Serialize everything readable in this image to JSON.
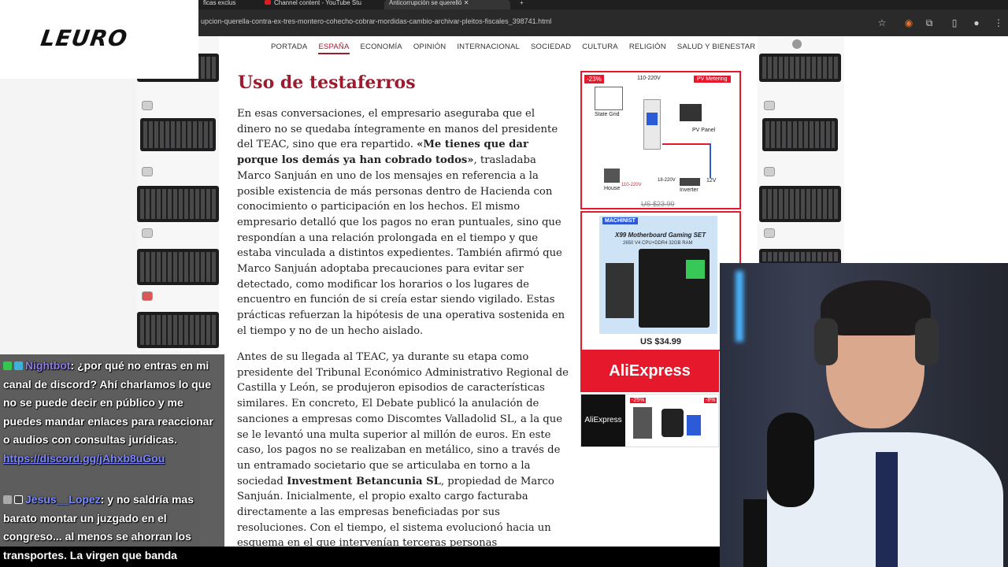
{
  "browser": {
    "tabs": [
      {
        "label": "ficas exclus"
      },
      {
        "label": "Channel content - YouTube Stu"
      },
      {
        "label": "Anticorrupción se querelló"
      }
    ],
    "url": "upcion-querella-contra-ex-tres-montero-cohecho-cobrar-mordidas-cambio-archivar-pleitos-fiscales_398741.html"
  },
  "logo": {
    "text": "LEURO"
  },
  "nav": {
    "items": [
      "PORTADA",
      "ESPAÑA",
      "ECONOMÍA",
      "OPINIÓN",
      "INTERNACIONAL",
      "SOCIEDAD",
      "CULTURA",
      "RELIGIÓN",
      "SALUD Y BIENESTAR"
    ],
    "active": "ESPAÑA"
  },
  "article": {
    "headline": "Uso de testaferros",
    "p1": {
      "a": "En esas conversaciones, el empresario aseguraba que el dinero no se quedaba íntegramente en manos del presidente del TEAC, sino que era repartido. ",
      "quote": "«Me tienes que dar porque los demás ya han cobrado todos»",
      "b": ", trasladaba Marco Sanjuán en uno de los mensajes en referencia a la posible existencia de más personas dentro de Hacienda con conocimiento o participación en los hechos. El mismo empresario detalló que los pagos no eran puntuales, sino que respondían a una relación prolongada en el tiempo y que estaba vinculada a distintos expedientes. También afirmó que Marco Sanjuán adoptaba precauciones para evitar ser detectado, como modificar los horarios o los lugares de encuentro en función de si creía estar siendo vigilado. Estas prácticas refuerzan la hipótesis de una operativa sostenida en el tiempo y no de un hecho aislado."
    },
    "p2": {
      "a": "Antes de su llegada al TEAC, ya durante su etapa como presidente del Tribunal Económico Administrativo Regional de Castilla y León, se produjeron episodios de características similares. En concreto, El Debate publicó la anulación de sanciones a empresas como Discomtes Valladolid SL, a la que se le levantó una multa superior al millón de euros. En este caso, los pagos no se realizaban en metálico, sino a través de un entramado societario que se articulaba en torno a la sociedad ",
      "bold": "Investment Betancunia SL",
      "b": ", propiedad de Marco Sanjuán. Inicialmente, el propio exalto cargo facturaba directamente a las empresas beneficiadas por sus resoluciones. Con el tiempo, el sistema evolucionó hacia un esquema en el que intervenían terceras personas"
    }
  },
  "ads": {
    "ad1": {
      "badge": "-23%",
      "label_pv": "PV Metering",
      "label_grid": "State Grid",
      "label_panel": "PV Panel",
      "label_house": "House",
      "label_inverter": "Inverter",
      "volt1": "110-220V",
      "volt2": "110-220V",
      "volt3": "18-220V",
      "volt4": "12V",
      "price": "US $23.90"
    },
    "ad2": {
      "brand": "MACHINIST",
      "title": "X99 Motherboard Gaming SET",
      "subtitle": "2650 V4 CPU+DDR4 32GB RAM",
      "price": "US $34.99"
    },
    "ad3": {
      "label": "AliExpress"
    },
    "ad4": {
      "label": "AliExpress",
      "badge1": "-25%",
      "badge2": "-8%"
    }
  },
  "chat": {
    "msg1": {
      "user": "Nightbot",
      "text": ": ¿por qué no entras en mi canal de discord? Ahí charlamos lo que no se puede decir en público y me puedes mandar enlaces para reaccionar o audios con consultas jurídicas.",
      "link": "https://discord.gg/jAhxb8uGou"
    },
    "msg2": {
      "user": "Jesus__Lopez",
      "text": ": y no saldría mas barato montar un juzgado en el congreso... al menos se ahorran los"
    }
  },
  "ticker": {
    "text": "transportes. La virgen que banda"
  },
  "colors": {
    "accent": "#9d1b2f",
    "ad_red": "#e5192b",
    "chat_user": "#8a7de0"
  }
}
